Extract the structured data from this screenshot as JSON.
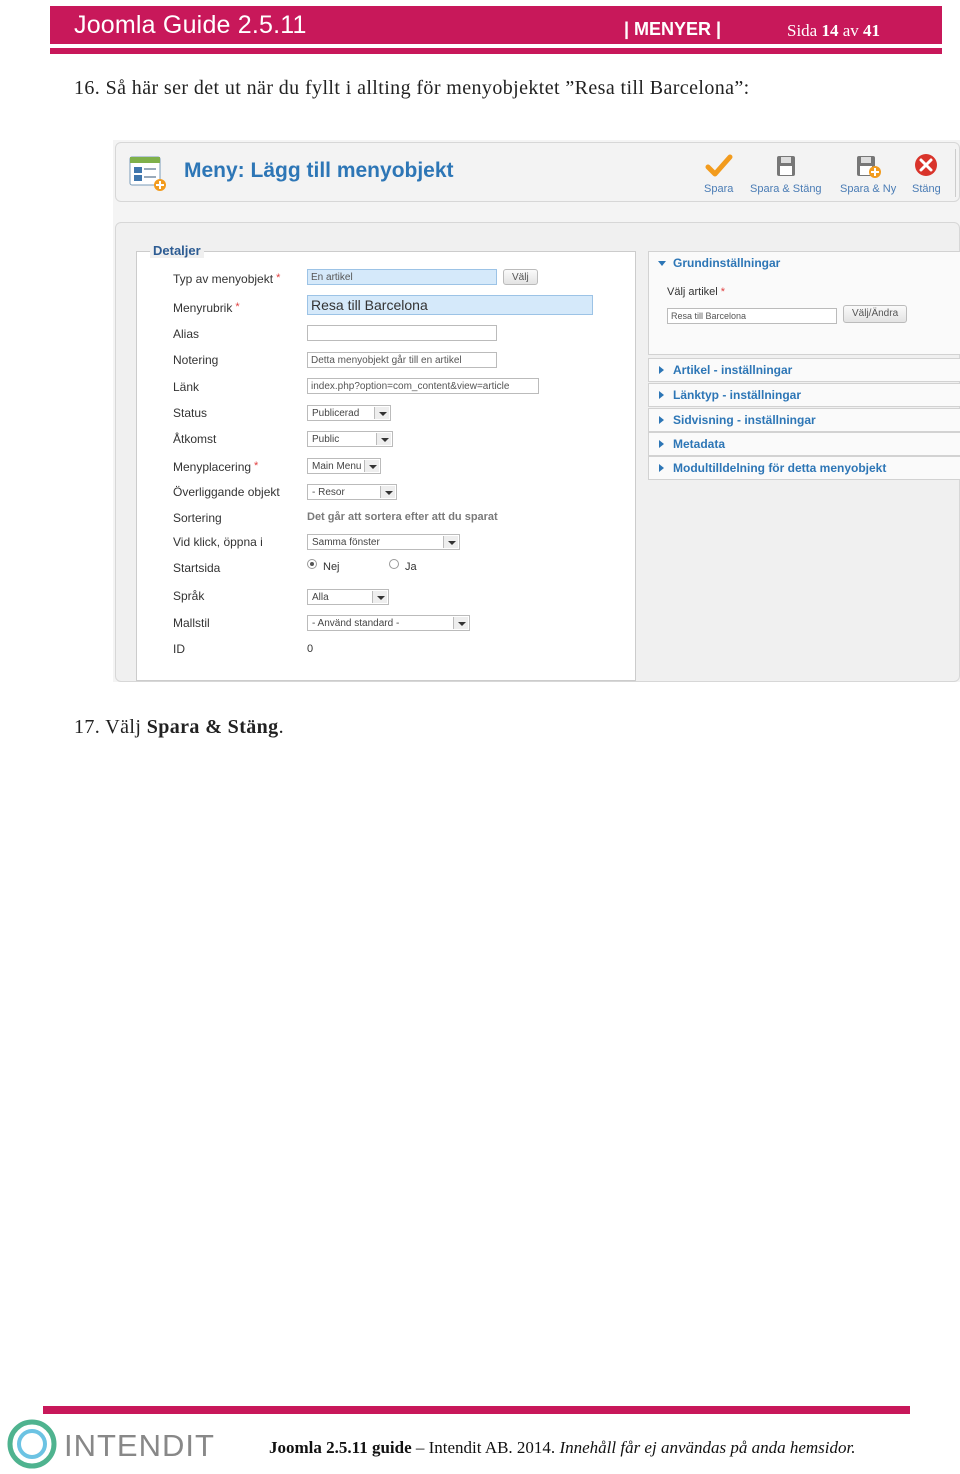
{
  "header": {
    "title": "Joomla Guide 2.5.11",
    "section": "| MENYER |",
    "page_word": "Sida",
    "page_current": "14",
    "page_of": "av",
    "page_total": "41"
  },
  "step16": "16. Så här ser det ut när du fyllt i allting för menyobjektet ”Resa till Barcelona”:",
  "screenshot": {
    "toolbar": {
      "title": "Meny: Lägg till menyobjekt",
      "buttons": [
        "Spara",
        "Spara & Stäng",
        "Spara & Ny",
        "Stäng"
      ]
    },
    "details_legend": "Detaljer",
    "fields": {
      "type_label": "Typ av menyobjekt",
      "type_value": "En artikel",
      "type_button": "Välj",
      "title_label": "Menyrubrik",
      "title_value": "Resa till Barcelona",
      "alias_label": "Alias",
      "alias_value": "",
      "note_label": "Notering",
      "note_value": "Detta menyobjekt går till en artikel",
      "link_label": "Länk",
      "link_value": "index.php?option=com_content&view=article",
      "status_label": "Status",
      "status_value": "Publicerad",
      "access_label": "Åtkomst",
      "access_value": "Public",
      "menu_label": "Menyplacering",
      "menu_value": "Main Menu",
      "parent_label": "Överliggande objekt",
      "parent_value": "- Resor",
      "order_label": "Sortering",
      "order_note": "Det går att sortera efter att du sparat",
      "target_label": "Vid klick, öppna i",
      "target_value": "Samma fönster",
      "home_label": "Startsida",
      "home_no": "Nej",
      "home_yes": "Ja",
      "home_selected": "Nej",
      "lang_label": "Språk",
      "lang_value": "Alla",
      "template_label": "Mallstil",
      "template_value": "- Använd standard -",
      "id_label": "ID",
      "id_value": "0"
    },
    "basic": {
      "heading": "Grundinställningar",
      "article_label": "Välj artikel",
      "article_value": "Resa till Barcelona",
      "article_button": "Välj/Ändra"
    },
    "panels": [
      "Artikel - inställningar",
      "Länktyp - inställningar",
      "Sidvisning - inställningar",
      "Metadata",
      "Modultilldelning för detta menyobjekt"
    ],
    "colors": {
      "accent": "#2d76b6",
      "required": "#e04040"
    }
  },
  "step17": {
    "prefix": "17. Välj ",
    "bold": "Spara & Stäng",
    "suffix": "."
  },
  "footer": {
    "logo_text": "INTENDIT",
    "guide_bold": "Joomla 2.5.11 guide",
    "company": " – Intendit AB. 2014. ",
    "notice": "Innehåll får ej användas på anda hemsidor."
  },
  "colors": {
    "brand": "#c8185a"
  }
}
